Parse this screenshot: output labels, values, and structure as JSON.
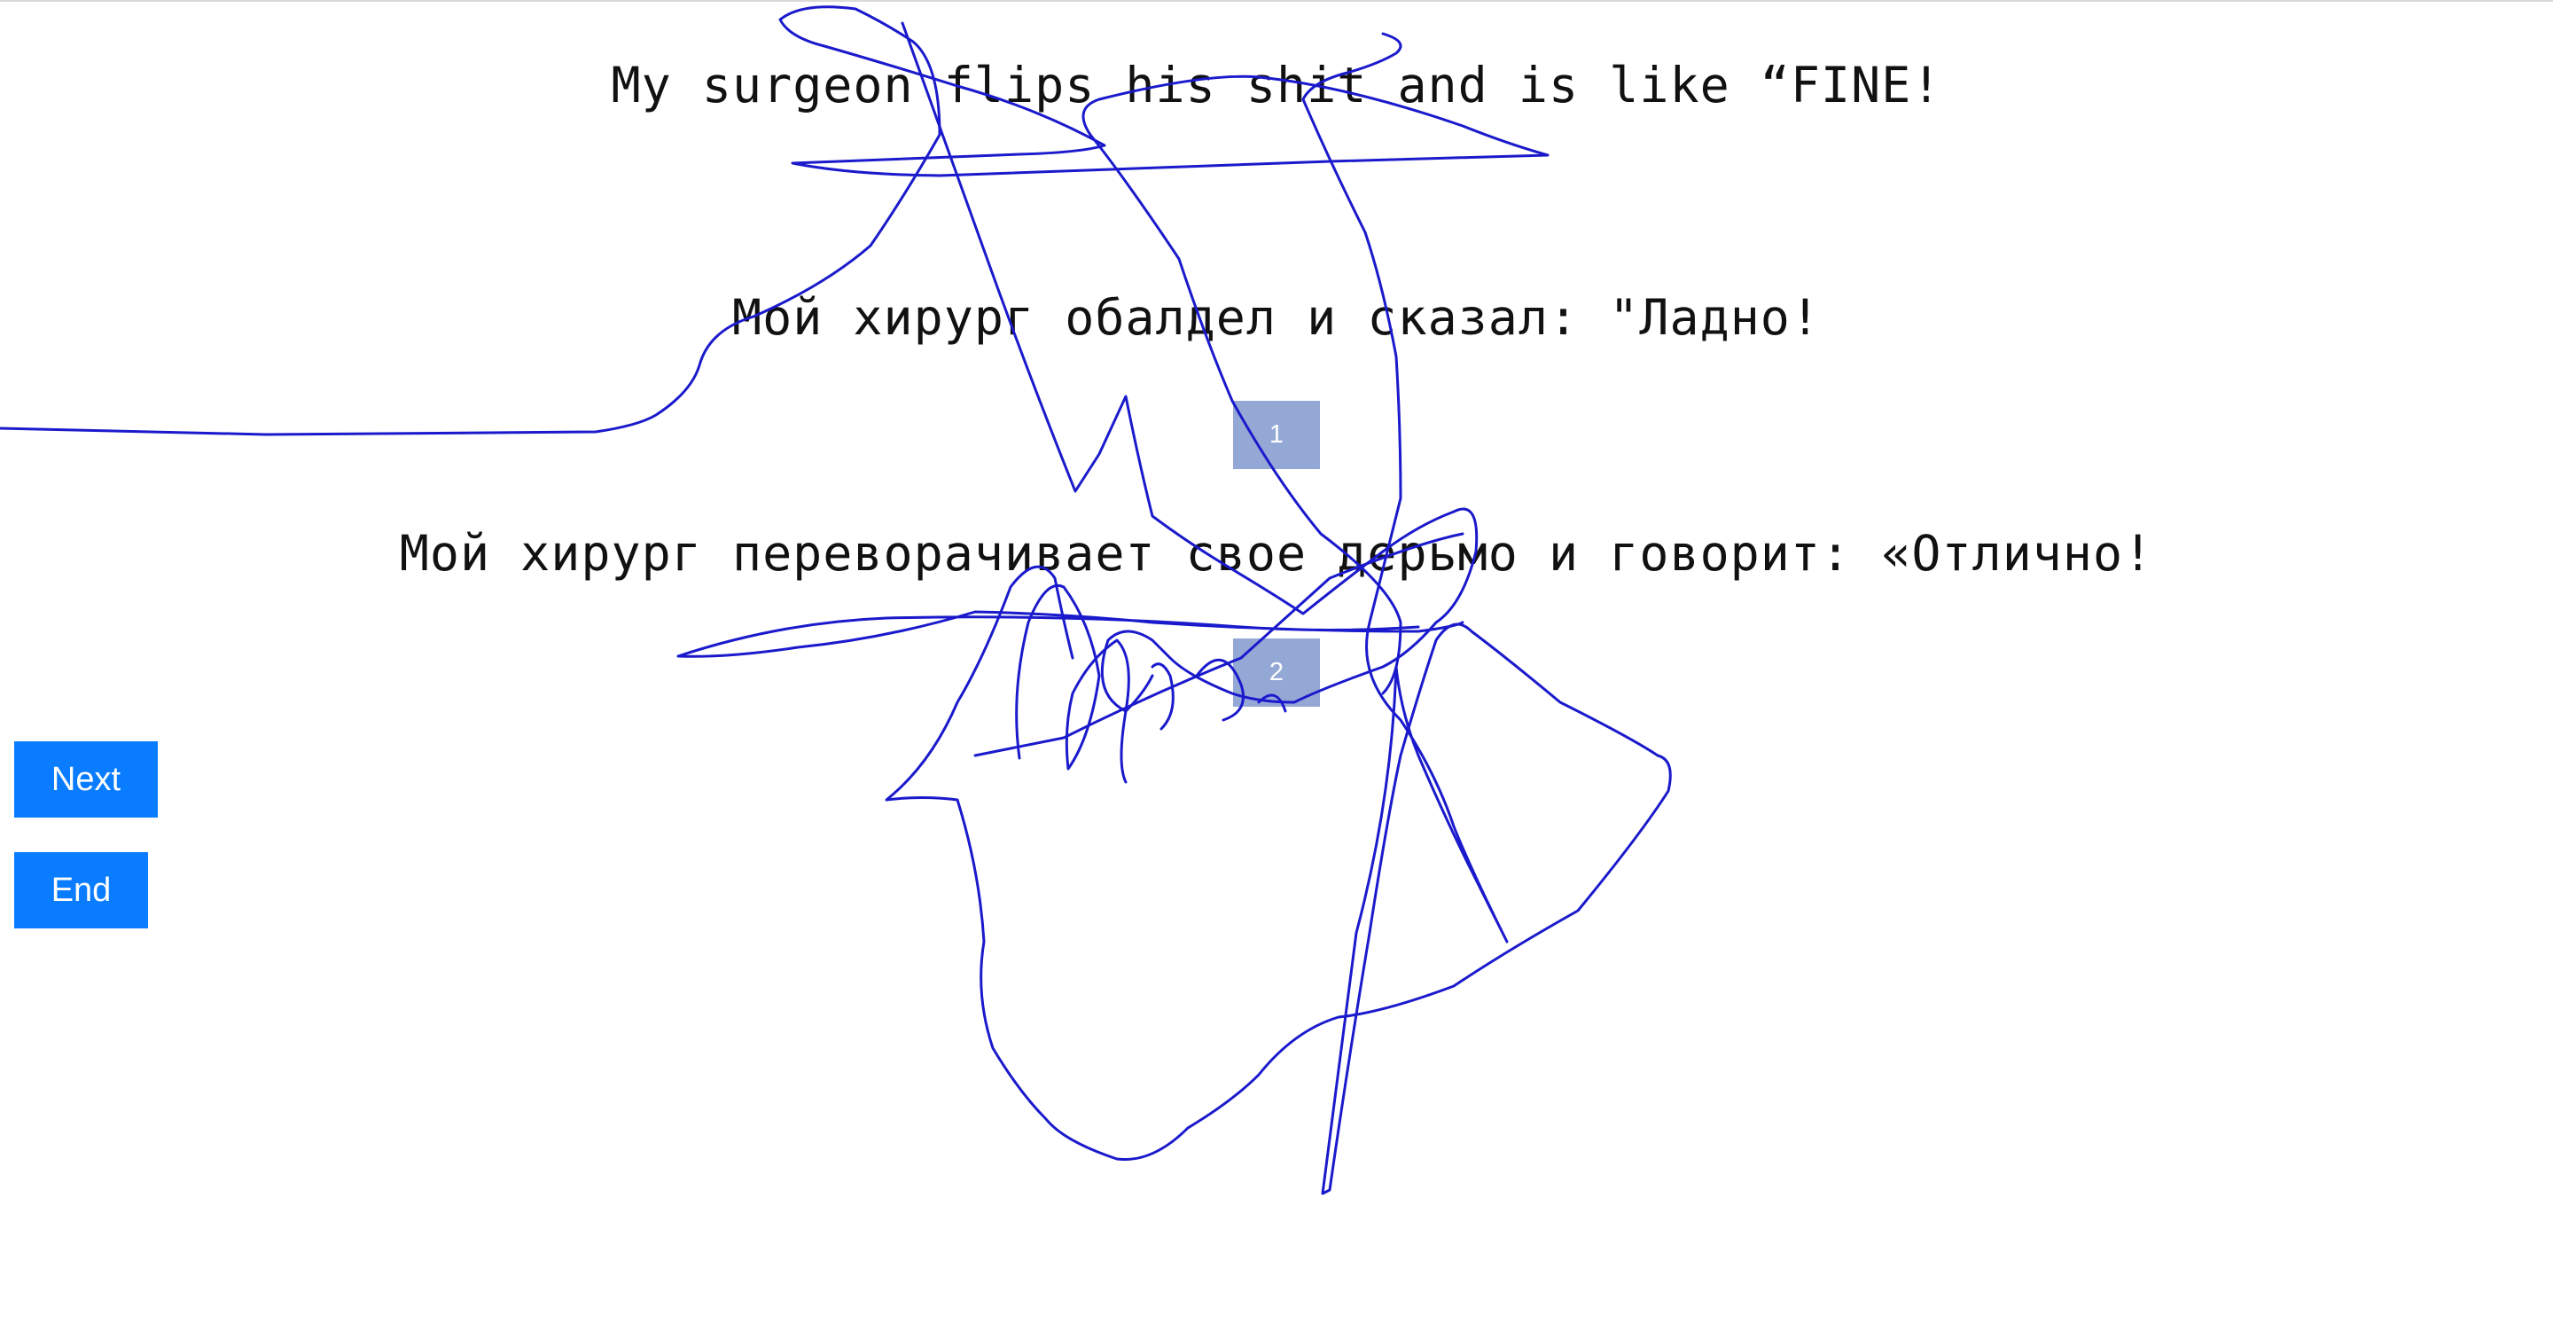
{
  "sentences": {
    "source": "My surgeon flips his shit and is like “FINE!",
    "translation_1": "Мой хирург обалдел и сказал: \"Ладно!",
    "translation_2": "Мой хирург переворачивает свое дерьмо и говорит: «Отлично!"
  },
  "rank_boxes": {
    "box_1": "1",
    "box_2": "2"
  },
  "buttons": {
    "next_label": "Next",
    "end_label": "End"
  },
  "colors": {
    "button_bg": "#0a7cff",
    "rank_box_bg": "#94a8d6",
    "scribble_stroke": "#1a1acc"
  }
}
